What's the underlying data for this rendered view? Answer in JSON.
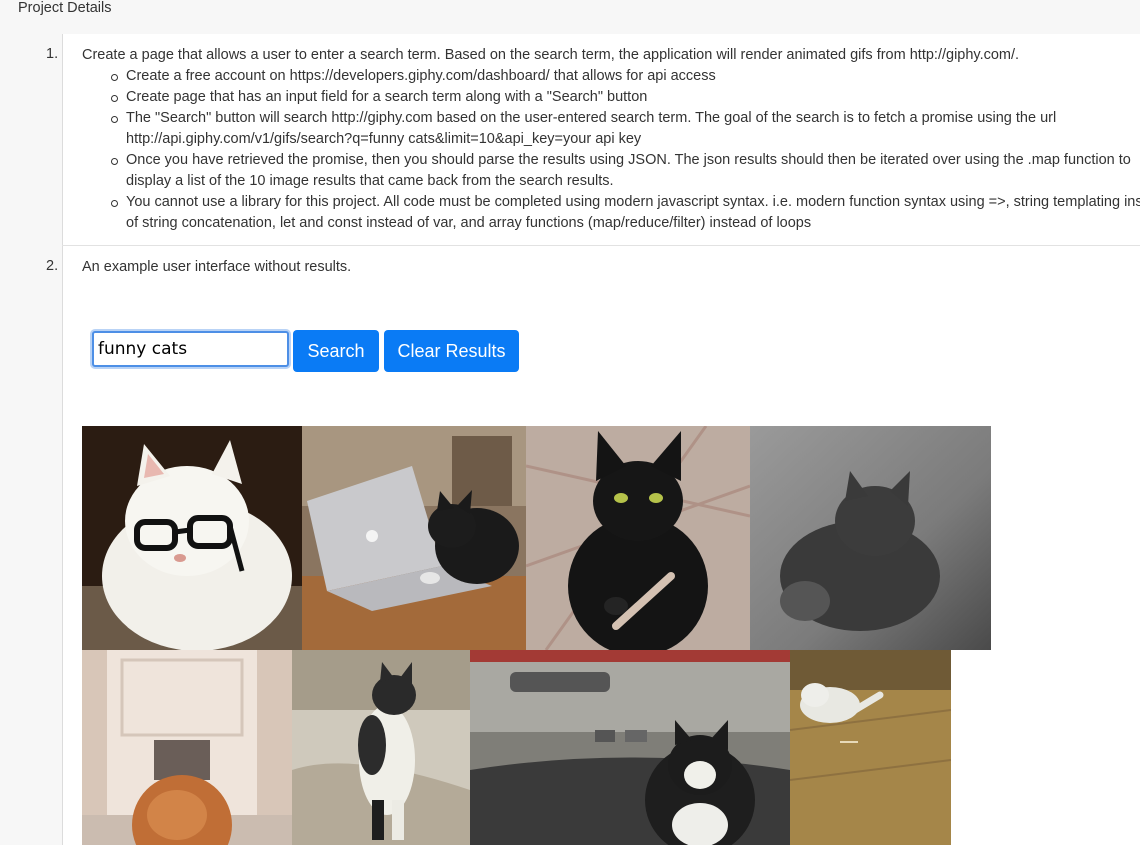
{
  "header": {
    "title": "Project Details"
  },
  "steps": [
    {
      "number": "1.",
      "text": "Create a page that allows a user to enter a search term. Based on the search term, the application will render animated gifs from http://giphy.com/.",
      "bullets": [
        "Create a free account on https://developers.giphy.com/dashboard/ that allows for api access",
        "Create page that has an input field for a search term along with a \"Search\" button",
        "The \"Search\" button will search http://giphy.com based on the user-entered search term. The goal of the search is to fetch a promise using the url http://api.giphy.com/v1/gifs/search?q=funny cats&limit=10&api_key=your api key",
        "Once you have retrieved the promise, then you should parse the results using JSON. The json results should then be iterated over using the .map function to display a list of the 10 image results that came back from the search results.",
        "You cannot use a library for this project. All code must be completed using modern javascript syntax. i.e. modern function syntax using =>, string templating instead of string concatenation, let and const instead of var, and array functions (map/reduce/filter) instead of loops"
      ]
    },
    {
      "number": "2.",
      "text": "An example user interface without results."
    }
  ],
  "example_ui": {
    "search_value": "funny cats",
    "search_button": "Search",
    "clear_button": "Clear Results",
    "accent_color": "#0a7bf5",
    "results": [
      {
        "alt": "white cat wearing glasses"
      },
      {
        "alt": "black cat typing on laptop"
      },
      {
        "alt": "black cat holding nail file"
      },
      {
        "alt": "grey kitten blurred motion"
      },
      {
        "alt": "orange cat going through cat door"
      },
      {
        "alt": "cat standing on hind legs"
      },
      {
        "alt": "black and white cat in car"
      },
      {
        "alt": "white cat on wooden floor"
      }
    ]
  }
}
